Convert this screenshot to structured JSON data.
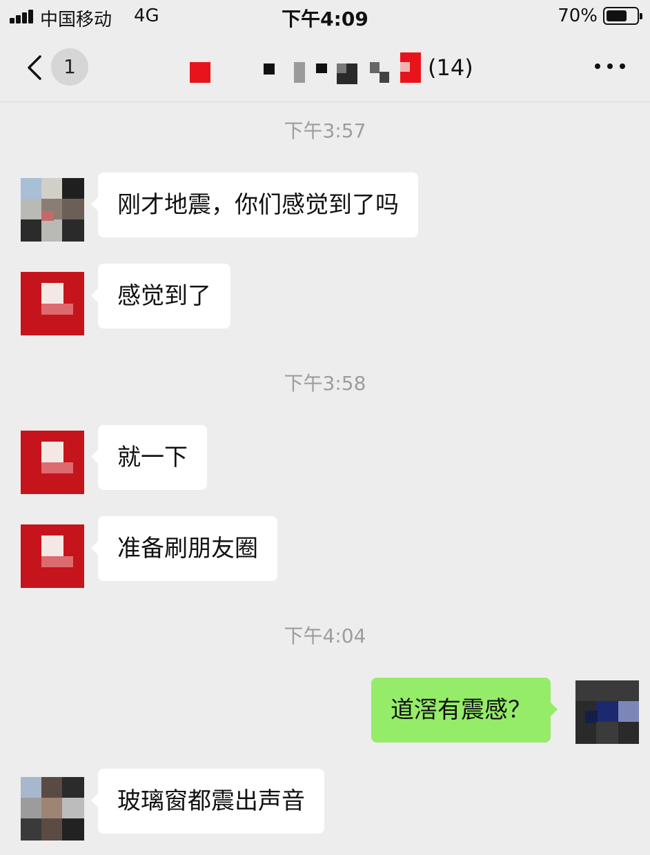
{
  "status_bar": {
    "carrier": "中国移动",
    "network": "4G",
    "time": "下午4:09",
    "battery_percent": "70%",
    "battery_level": 0.7
  },
  "nav_bar": {
    "unread_count": "1",
    "member_count": "(14)",
    "back_icon": "chevron-left-icon",
    "more_icon": "more-dots-icon"
  },
  "messages": [
    {
      "type": "time",
      "text": "下午3:57"
    },
    {
      "type": "text",
      "side": "left",
      "avatar": "pixelated-avatar-a",
      "text": "刚才地震，你们感觉到了吗"
    },
    {
      "type": "text",
      "side": "left",
      "avatar": "pixelated-avatar-red",
      "text": "感觉到了"
    },
    {
      "type": "time",
      "text": "下午3:58"
    },
    {
      "type": "text",
      "side": "left",
      "avatar": "pixelated-avatar-red",
      "text": "就一下"
    },
    {
      "type": "text",
      "side": "left",
      "avatar": "pixelated-avatar-red",
      "text": "准备刷朋友圈"
    },
    {
      "type": "time",
      "text": "下午4:04"
    },
    {
      "type": "text",
      "side": "right",
      "avatar": "pixelated-avatar-self",
      "text": "道滘有震感？"
    },
    {
      "type": "text",
      "side": "left",
      "avatar": "pixelated-avatar-b",
      "text": "玻璃窗都震出声音"
    }
  ],
  "colors": {
    "background": "#ededed",
    "incoming_bubble": "#ffffff",
    "outgoing_bubble": "#95ec69",
    "timestamp_text": "#9d9d9d",
    "avatar_red": "#c5141c"
  }
}
